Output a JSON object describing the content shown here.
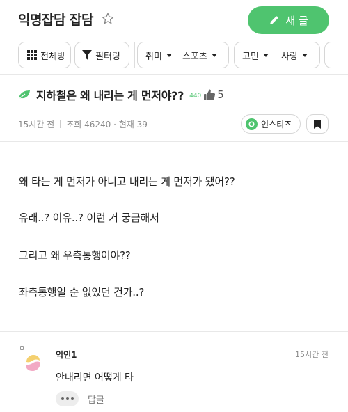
{
  "header": {
    "board_title": "익명잡담 잡담",
    "new_post_label": "새 글"
  },
  "filters": {
    "all_label": "전체방",
    "filter_label": "필터링",
    "chips": [
      {
        "label": "취미"
      },
      {
        "label": "스포츠"
      },
      {
        "label": "고민"
      },
      {
        "label": "사랑"
      }
    ]
  },
  "post": {
    "title": "지하철은 왜 내리는 게 먼저야??",
    "points": "440",
    "like_count": "5",
    "time_ago": "15시간 전",
    "views": "조회 46240 · 현재 39",
    "source_label": "인스티즈",
    "body": [
      "왜 타는 게 먼저가 아니고 내리는 게 먼저가 됐어??",
      "유래..? 이유..? 이런 거 궁금해서",
      "그리고 왜 우측통행이야??",
      "좌측통행일 순 없었던 건가..?"
    ]
  },
  "comment": {
    "author": "익인1",
    "time_ago": "15시간 전",
    "text": "안내리면 어떻게 타",
    "reply_label": "답글"
  },
  "colors": {
    "accent": "#4fc46f",
    "text": "#222222",
    "muted": "#8a8a8a",
    "border": "#d6d6d6"
  }
}
